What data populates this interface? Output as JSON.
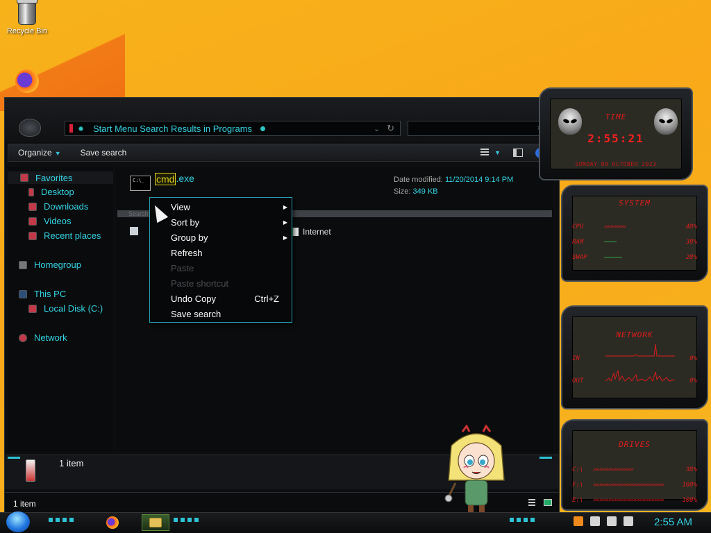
{
  "desktop": {
    "icons": [
      {
        "label": "Recycle Bin",
        "icon": "recycle-bin-icon"
      },
      {
        "label": "",
        "icon": "firefox-icon"
      }
    ]
  },
  "explorer": {
    "address": "Start Menu Search Results in Programs",
    "search_placeholder": "",
    "toolbar": {
      "organize": "Organize",
      "save_search": "Save search"
    },
    "nav": {
      "favorites": "Favorites",
      "desktop": "Desktop",
      "downloads": "Downloads",
      "videos": "Videos",
      "recent": "Recent places",
      "homegroup": "Homegroup",
      "thispc": "This PC",
      "localdisk": "Local Disk (C:)",
      "network": "Network"
    },
    "file": {
      "name_match": "cmd",
      "name_rest": ".exe",
      "date_label": "Date modified:",
      "date_value": "11/20/2014 9:14 PM",
      "size_label": "Size:",
      "size_value": "349 KB"
    },
    "search_again_label": "Search again in:",
    "search_again_internet": "Internet",
    "details_count": "1 item",
    "status_count": "1 item"
  },
  "context_menu": {
    "view": "View",
    "sort_by": "Sort by",
    "group_by": "Group by",
    "refresh": "Refresh",
    "paste": "Paste",
    "paste_shortcut": "Paste shortcut",
    "undo_copy": "Undo Copy",
    "undo_copy_shortcut": "Ctrl+Z",
    "save_search": "Save search"
  },
  "gadgets": {
    "time": {
      "title": "TIME",
      "clock": "2:55:21",
      "date": "SUNDAY 09 OCTOBER 2023"
    },
    "system": {
      "title": "SYSTEM",
      "rows": [
        {
          "label": "CPU",
          "bar": "»»»»»»»",
          "value": "48%"
        },
        {
          "label": "RAM",
          "bar": "",
          "value": "38%"
        },
        {
          "label": "SWAP",
          "bar": "",
          "value": "28%"
        }
      ]
    },
    "network": {
      "title": "NETWORK",
      "in_label": "IN",
      "in_value": "0%",
      "out_label": "OUT",
      "out_value": "0%"
    },
    "drives": {
      "title": "DRIVES",
      "rows": [
        {
          "label": "C:\\",
          "bar": "»»»»»»»»»»»»»",
          "value": "38%"
        },
        {
          "label": "F:\\",
          "bar": "»»»»»»»»»»»»»»»»»»»»»»»",
          "value": "100%"
        },
        {
          "label": "E:\\",
          "bar": "»»»»»»»»»»»»»»»»»»»»»»»",
          "value": "100%"
        }
      ]
    }
  },
  "taskbar": {
    "clock": "2:55 AM"
  },
  "colors": {
    "accent": "#35d4e6",
    "gadget_red": "#e01c1c",
    "wallpaper": "#f7b21a"
  }
}
